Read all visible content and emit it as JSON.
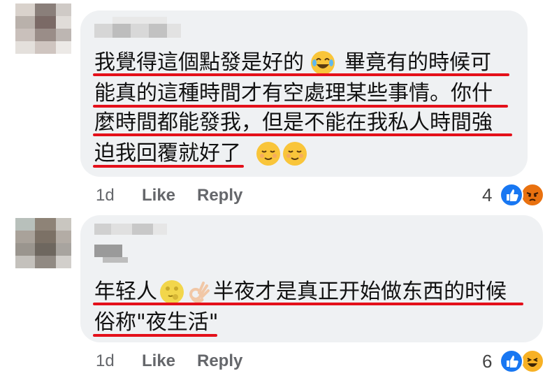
{
  "comments": [
    {
      "lines": [
        "我覺得這個點發是好的",
        "畢竟有的時候可",
        "能真的這種時間才有空處理某些事情。你什",
        "麼時間都能發我，但是不能在我私人時間強",
        "迫我回覆就好了"
      ],
      "time": "1d",
      "like_label": "Like",
      "reply_label": "Reply",
      "reaction_count": "4",
      "reactions": [
        "like-reaction-icon",
        "angry-reaction-icon"
      ]
    },
    {
      "lines": [
        "年轻人",
        "半夜才是真正开始做东西的时候",
        "俗称\"夜生活\""
      ],
      "time": "1d",
      "like_label": "Like",
      "reply_label": "Reply",
      "reaction_count": "6",
      "reactions": [
        "like-reaction-icon",
        "laugh-reaction-icon"
      ]
    }
  ],
  "colors": {
    "bubble": "#eff1f3",
    "underline": "#e4101a",
    "meta_text": "#65676b",
    "like_blue": "#1877f2",
    "angry_orange": "#e9710f",
    "laugh_yellow": "#f7b125"
  }
}
